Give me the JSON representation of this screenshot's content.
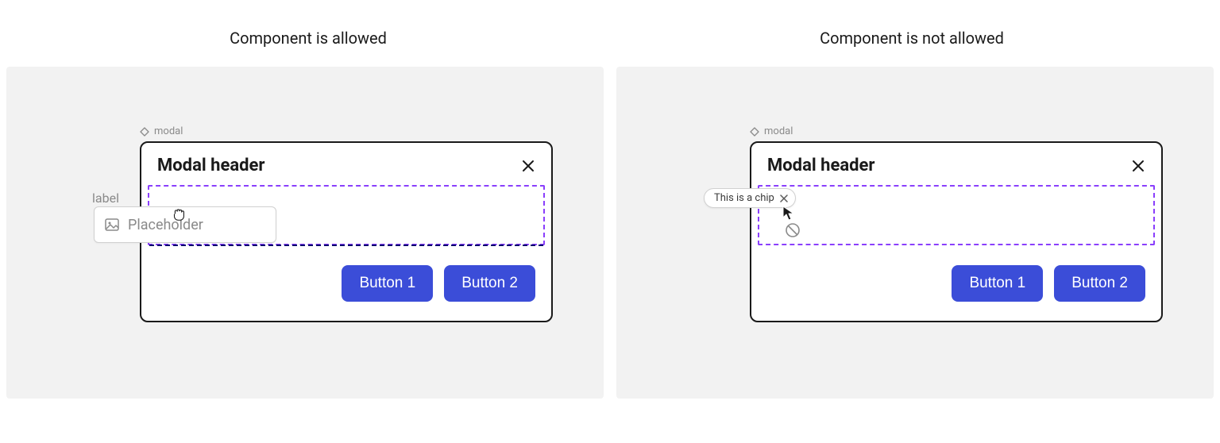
{
  "titles": {
    "allowed": "Component is allowed",
    "not_allowed": "Component is not allowed"
  },
  "left": {
    "tag": "modal",
    "modal_header": "Modal header",
    "label": "label",
    "placeholder": "Placeholder",
    "button1": "Button 1",
    "button2": "Button 2"
  },
  "right": {
    "tag": "modal",
    "modal_header": "Modal header",
    "chip_text": "This is a chip",
    "button1": "Button 1",
    "button2": "Button 2"
  },
  "colors": {
    "primary_button": "#3b4dd8",
    "slot_dashed": "#8a3ffc",
    "panel_bg": "#f2f2f2"
  }
}
